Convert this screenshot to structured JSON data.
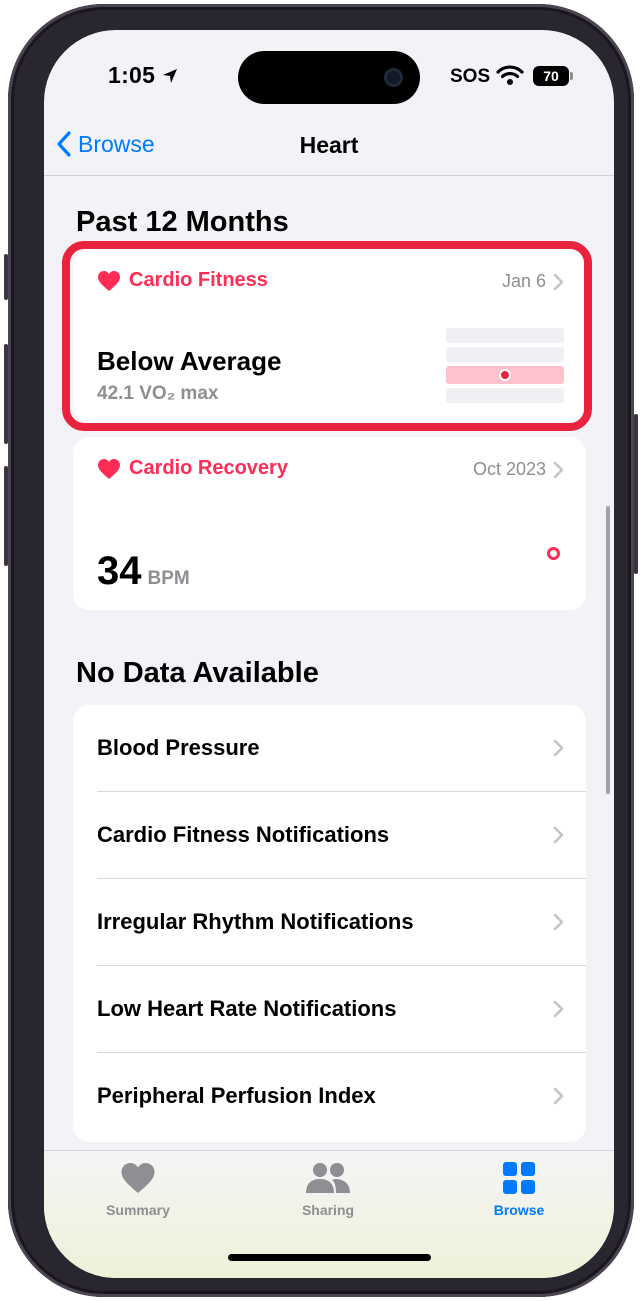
{
  "status_bar": {
    "time": "1:05",
    "sos": "SOS",
    "battery": "70"
  },
  "nav": {
    "back_label": "Browse",
    "title": "Heart"
  },
  "section_past": {
    "title": "Past 12 Months"
  },
  "cardio_fitness": {
    "title": "Cardio Fitness",
    "date": "Jan 6",
    "level": "Below Average",
    "value": "42.1 VO₂ max",
    "chart_active_row": 3,
    "chart_rows": 4
  },
  "cardio_recovery": {
    "title": "Cardio Recovery",
    "date": "Oct 2023",
    "value": "34",
    "unit": "BPM"
  },
  "section_nodata": {
    "title": "No Data Available",
    "items": [
      {
        "label": "Blood Pressure"
      },
      {
        "label": "Cardio Fitness Notifications"
      },
      {
        "label": "Irregular Rhythm Notifications"
      },
      {
        "label": "Low Heart Rate Notifications"
      },
      {
        "label": "Peripheral Perfusion Index"
      }
    ]
  },
  "tabbar": {
    "tabs": [
      {
        "label": "Summary",
        "icon": "heart-icon",
        "active": false
      },
      {
        "label": "Sharing",
        "icon": "people-icon",
        "active": false
      },
      {
        "label": "Browse",
        "icon": "grid-icon",
        "active": true
      }
    ],
    "active_color": "#007aff",
    "inactive_color": "#8e8e93"
  },
  "colors": {
    "accent": "#ff2d55",
    "highlight_border": "#e8223f",
    "link": "#007aff"
  }
}
